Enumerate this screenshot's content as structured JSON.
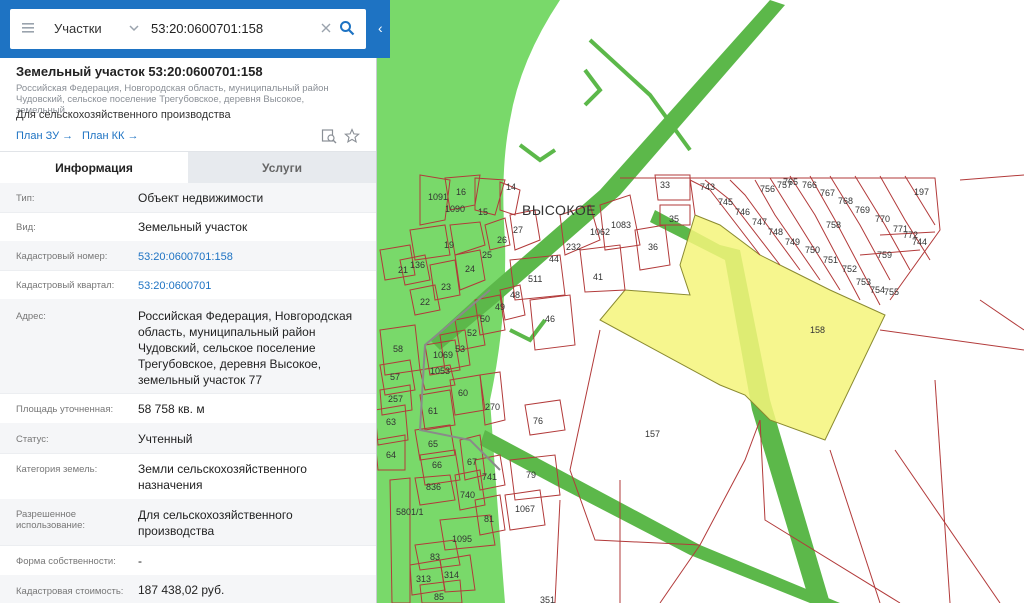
{
  "search": {
    "type_label": "Участки",
    "query": "53:20:0600701:158"
  },
  "parcel": {
    "title": "Земельный участок 53:20:0600701:158",
    "address_short": "Российская Федерация, Новгородская область, муниципальный район Чудовский, сельское поселение Трегубовское, деревня Высокое, земельный...",
    "purpose": "Для сельскохозяйственного производства",
    "plan_zu": "План ЗУ",
    "plan_kk": "План КК"
  },
  "tabs": {
    "info": "Информация",
    "services": "Услуги"
  },
  "properties": [
    {
      "key": "Тип:",
      "value": "Объект недвижимости"
    },
    {
      "key": "Вид:",
      "value": "Земельный участок"
    },
    {
      "key": "Кадастровый номер:",
      "value": "53:20:0600701:158"
    },
    {
      "key": "Кадастровый квартал:",
      "value": "53:20:0600701"
    },
    {
      "key": "Адрес:",
      "value": "Российская Федерация, Новгородская область, муниципальный район Чудовский, сельское поселение Трегубовское, деревня Высокое, земельный участок 77"
    },
    {
      "key": "Площадь уточненная:",
      "value": "58 758 кв. м"
    },
    {
      "key": "Статус:",
      "value": "Учтенный"
    },
    {
      "key": "Категория земель:",
      "value": "Земли сельскохозяйственного назначения"
    },
    {
      "key": "Разрешенное использование:",
      "value": "Для сельскохозяйственного производства"
    },
    {
      "key": "Форма собственности:",
      "value": "-"
    },
    {
      "key": "Кадастровая стоимость:",
      "value": "187 438,02 руб."
    }
  ],
  "map": {
    "settlement": "ВЫСОКОЕ",
    "plot_labels": [
      "1091",
      "16",
      "1090",
      "15",
      "14",
      "19",
      "27",
      "26",
      "25",
      "24",
      "22",
      "21",
      "136",
      "23",
      "44",
      "511",
      "232",
      "1062",
      "1083",
      "41",
      "36",
      "35",
      "33",
      "49",
      "48",
      "46",
      "50",
      "52",
      "53",
      "58",
      "57",
      "257",
      "63",
      "1069",
      "1053",
      "60",
      "61",
      "65",
      "66",
      "67",
      "64",
      "836",
      "740",
      "741",
      "270",
      "76",
      "79",
      "1067",
      "81",
      "1095",
      "83",
      "313",
      "314",
      "85",
      "5801/1",
      "743",
      "745",
      "746",
      "747",
      "748",
      "749",
      "750",
      "751",
      "752",
      "753",
      "754",
      "755",
      "756",
      "757",
      "758",
      "759",
      "765",
      "766",
      "767",
      "768",
      "769",
      "770",
      "771",
      "772",
      "744",
      "197",
      "157",
      "158",
      "351"
    ],
    "highlight_plot": "158",
    "colors": {
      "green": "#79d96a",
      "road": "#5cb84a",
      "boundary": "#b23a3a",
      "highlight": "#f5f57a",
      "accent": "#1e73c3"
    }
  },
  "icons": [
    "menu-icon",
    "chevron-down-icon",
    "clear-icon",
    "search-icon",
    "collapse-icon",
    "arrow-right-icon",
    "find-on-map-icon",
    "star-icon"
  ]
}
